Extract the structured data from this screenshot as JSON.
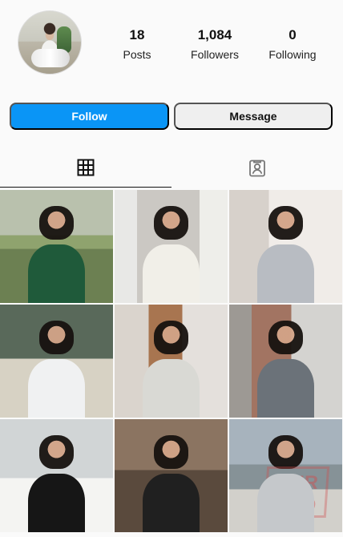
{
  "profile": {
    "stats": [
      {
        "value": "18",
        "label": "Posts"
      },
      {
        "value": "1,084",
        "label": "Followers"
      },
      {
        "value": "0",
        "label": "Following"
      }
    ],
    "follow_label": "Follow",
    "message_label": "Message"
  },
  "tabs": {
    "grid_icon": "grid-icon",
    "tagged_icon": "tagged-photos-icon"
  },
  "posts": [
    "photo-post",
    "photo-post",
    "photo-post",
    "photo-post",
    "photo-post",
    "photo-post",
    "photo-post",
    "photo-post",
    "photo-post"
  ],
  "watermark": {
    "line1": "DNR",
    "line2": "RED"
  },
  "colors": {
    "follow_button": "#0a95f6",
    "message_button": "#efefef",
    "background": "#fafafa"
  }
}
